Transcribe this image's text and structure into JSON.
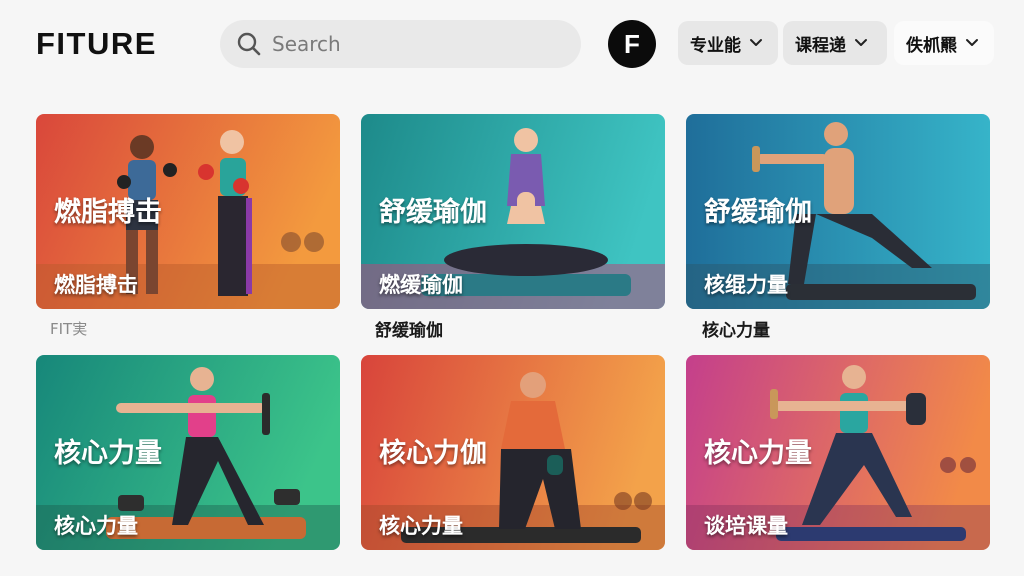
{
  "header": {
    "logo": "FITURE",
    "search_placeholder": "Search",
    "avatar_letter": "F",
    "dropdowns": [
      {
        "label": "专业能"
      },
      {
        "label": "课程递"
      },
      {
        "label": "佚枛羆"
      }
    ]
  },
  "cards": [
    {
      "title": "燃脂搏击",
      "subtitle": "燃脂搏击",
      "caption": "FIT実",
      "colors": [
        "#d84a3a",
        "#f08a3a"
      ]
    },
    {
      "title": "舒缓瑜伽",
      "subtitle": "燃缓瑜伽",
      "caption": "舒缓瑜伽",
      "colors": [
        "#1f8f8c",
        "#37c2c0"
      ]
    },
    {
      "title": "舒缓瑜伽",
      "subtitle": "核绲力量",
      "caption": "核心力量",
      "colors": [
        "#1f6f9a",
        "#33b3c8"
      ]
    },
    {
      "title": "核心力量",
      "subtitle": "核心力量",
      "caption": "",
      "colors": [
        "#1a8a78",
        "#3cc18a"
      ]
    },
    {
      "title": "核心力伽",
      "subtitle": "核心力量",
      "caption": "",
      "colors": [
        "#d9453a",
        "#f2953e"
      ]
    },
    {
      "title": "核心力量",
      "subtitle": "谈培课量",
      "caption": "",
      "colors": [
        "#c43f8a",
        "#f08a4a"
      ]
    }
  ]
}
